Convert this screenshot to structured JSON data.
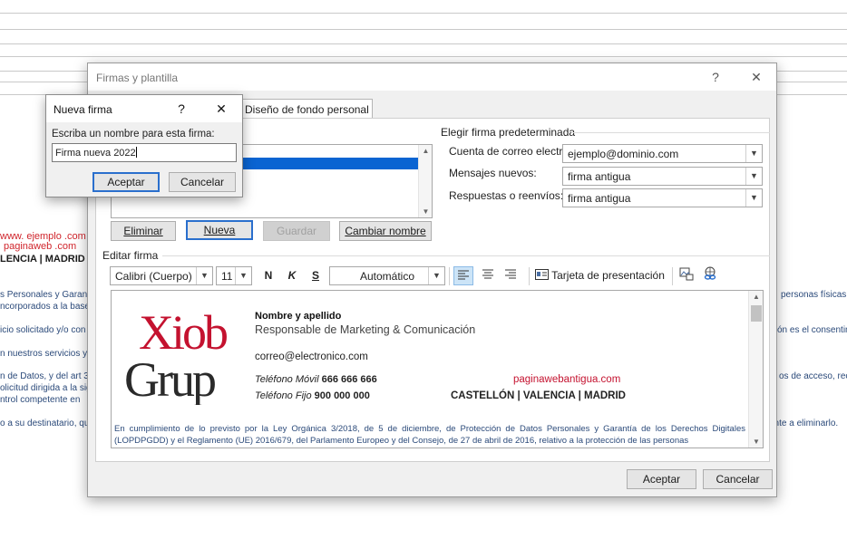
{
  "background": {
    "red_lines": [
      "www. ejemplo .com",
      "paginaweb .com"
    ],
    "cities_partial": "LENCIA | MADRID",
    "left_fragments": [
      "s Personales y Garant",
      "ncorporados a la base",
      "icio solicitado y/o con",
      "n nuestros servicios y",
      "n de Datos, y del art 3",
      "olicitud dirigida a la sig",
      "ntrol competente en",
      "o a su destinatario, qu"
    ],
    "right_fragments": [
      "personas físicas e",
      "ón es el consentim",
      "os de acceso, rect",
      "ente a eliminarlo."
    ]
  },
  "dialog": {
    "title": "Firmas y plantilla",
    "help": "?",
    "close": "✕",
    "tab_label": "Diseño de fondo personal",
    "left_group": {
      "buttons": {
        "delete": "Eliminar",
        "new": "Nueva",
        "save": "Guardar",
        "rename": "Cambiar nombre"
      }
    },
    "default_group": {
      "title": "Elegir firma predeterminada",
      "account_label": "Cuenta de correo electrónico:",
      "account_value": "ejemplo@dominio.com",
      "new_messages_label": "Mensajes nuevos:",
      "new_messages_value": "firma antigua",
      "replies_label": "Respuestas o reenvíos:",
      "replies_value": "firma antigua"
    },
    "edit_label": "Editar firma",
    "toolbar": {
      "font": "Calibri (Cuerpo)",
      "size": "11",
      "bold": "N",
      "italic": "K",
      "underline": "S",
      "color": "Automático",
      "business_card": "Tarjeta de presentación"
    },
    "signature": {
      "logo_line1": "Xiob",
      "logo_line2": "Grup",
      "name": "Nombre y apellido",
      "role": "Responsable de Marketing & Comunicación",
      "email": "correo@electronico.com",
      "mobile_label": "Teléfono Móvil",
      "mobile_value": "666 666 666",
      "fixed_label": "Teléfono Fijo",
      "fixed_value": "900 000 000",
      "web": "paginawebantigua.com",
      "cities": "CASTELLÓN | VALENCIA | MADRID",
      "legal": "En cumplimiento de lo previsto por la Ley Orgánica 3/2018, de 5 de diciembre, de Protección de Datos Personales y Garantía de los Derechos Digitales (LOPDPGDD) y el Reglamento (UE) 2016/679, del Parlamento Europeo y del Consejo, de 27 de abril de 2016, relativo a la protección de las personas"
    },
    "ok": "Aceptar",
    "cancel": "Cancelar"
  },
  "new_signature_dialog": {
    "title": "Nueva firma",
    "help": "?",
    "close": "✕",
    "prompt": "Escriba un nombre para esta firma:",
    "value": "Firma nueva 2022",
    "ok": "Aceptar",
    "cancel": "Cancelar"
  },
  "colors": {
    "selection": "#0a64d2",
    "accent_border": "#2a6fcd",
    "logo_red": "#c4122f",
    "logo_dark": "#2a2a2a"
  }
}
